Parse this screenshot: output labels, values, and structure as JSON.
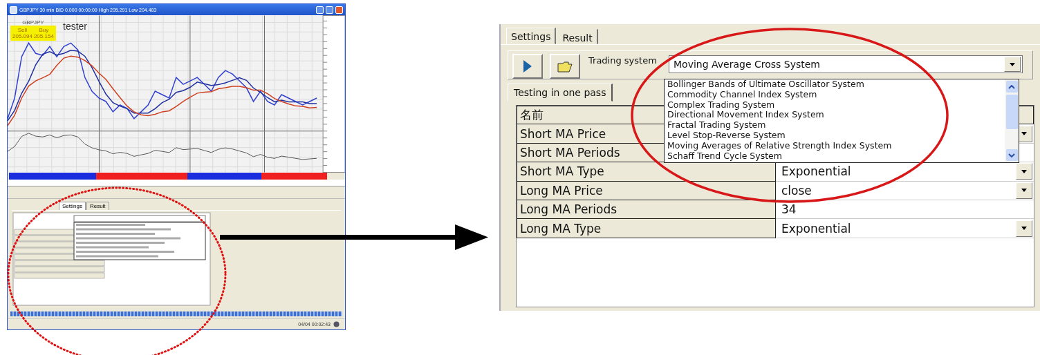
{
  "source_window": {
    "title": "GBPJPY 30 min BID 0.000 00:00:00 High 205.291 Low 204.483",
    "symbol": "GBPJPY",
    "sell_label": "Sell",
    "buy_label": "Buy",
    "sell_price": "205.094",
    "buy_price": "205.154",
    "chart_caption": "tester",
    "tabs": [
      {
        "label": "Settings",
        "selected": true
      },
      {
        "label": "Result",
        "selected": false
      }
    ],
    "status_time": "04/04 00:02:43"
  },
  "settings_panel": {
    "tabs": [
      {
        "label": "Settings",
        "selected": true
      },
      {
        "label": "Result",
        "selected": false
      }
    ],
    "trading_system_label": "Trading system",
    "trading_system_value": "Moving Average Cross System",
    "dropdown_options": [
      "Bollinger Bands of Ultimate Oscillator System",
      "Commodity Channel Index System",
      "Complex Trading System",
      "Directional Movement Index System",
      "Fractal Trading System",
      "Level Stop-Reverse System",
      "Moving Averages of Relative Strength Index System",
      "Schaff Trend Cycle System"
    ],
    "subtab": {
      "label": "Testing in one pass",
      "selected": true
    },
    "grid": {
      "header": "名前",
      "rows": [
        {
          "name": "Short MA Price",
          "kind": "dropdown"
        },
        {
          "name": "Short MA Periods",
          "kind": "text"
        },
        {
          "name": "Short MA Type",
          "kind": "dropdown",
          "value": "Exponential"
        },
        {
          "name": "Long MA Price",
          "kind": "dropdown",
          "value": "close"
        },
        {
          "name": "Long MA Periods",
          "kind": "text",
          "value": "34"
        },
        {
          "name": "Long MA Type",
          "kind": "dropdown",
          "value": "Exponential"
        }
      ]
    }
  }
}
